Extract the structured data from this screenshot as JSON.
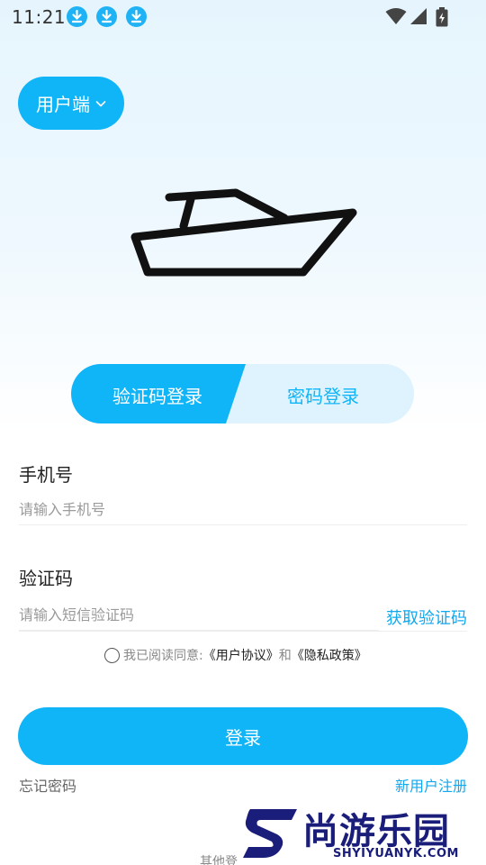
{
  "status_bar": {
    "time": "11:21",
    "notification_icons": [
      "download-icon",
      "download-icon",
      "download-icon"
    ],
    "system_icons": [
      "wifi-icon",
      "signal-icon",
      "battery-charging-icon"
    ]
  },
  "role_switch": {
    "label": "用户端",
    "icon": "chevron-down-icon"
  },
  "logo": {
    "icon": "boat-icon"
  },
  "tabs": [
    {
      "label": "验证码登录",
      "active": true
    },
    {
      "label": "密码登录",
      "active": false
    }
  ],
  "form": {
    "phone": {
      "label": "手机号",
      "placeholder": "请输入手机号",
      "value": ""
    },
    "code": {
      "label": "验证码",
      "placeholder": "请输入短信验证码",
      "value": "",
      "get_code_label": "获取验证码"
    }
  },
  "agreement": {
    "prefix": "我已阅读同意:",
    "user_agreement": "《用户协议》",
    "conjunction": "和",
    "privacy_policy": "《隐私政策》",
    "checked": false
  },
  "actions": {
    "login_label": "登录",
    "forgot_password": "忘记密码",
    "register": "新用户注册",
    "other_login": "其他登"
  },
  "watermark": {
    "cn": "尚游乐园",
    "en": "SHYIYUANYK.COM"
  },
  "colors": {
    "primary": "#10b5f7",
    "tab_inactive_bg": "#def3fd",
    "link": "#10a8ef"
  }
}
